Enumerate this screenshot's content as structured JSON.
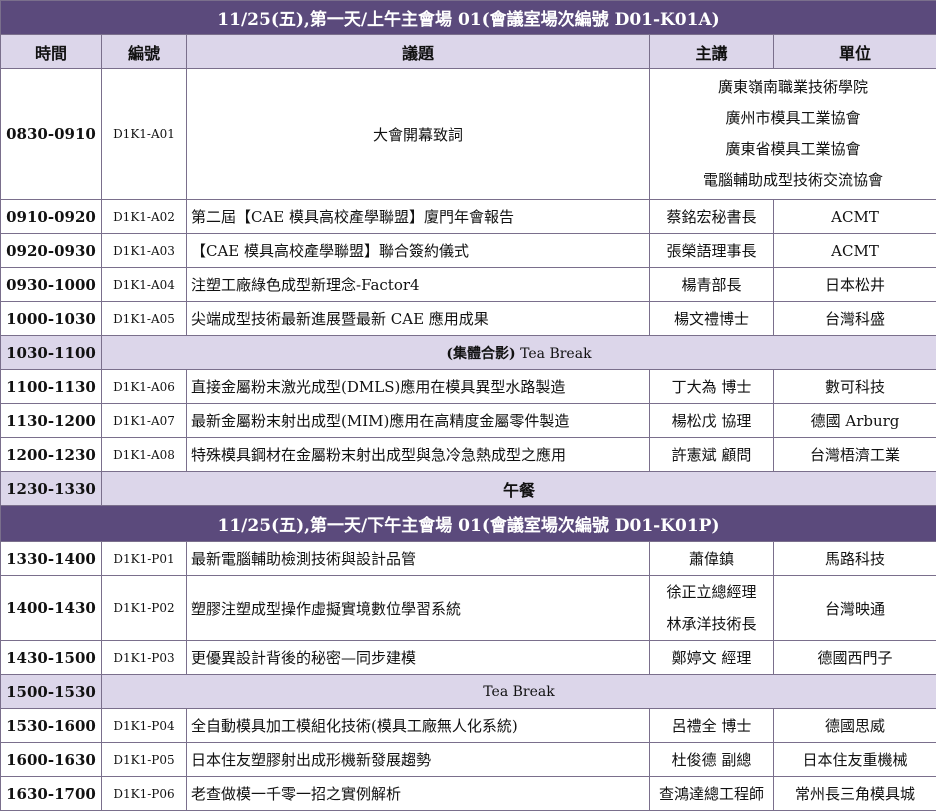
{
  "morning": {
    "banner": "11/25(五),第一天/上午主會場 01(會議室場次編號 D01-K01A)",
    "headers": {
      "time": "時間",
      "code": "編號",
      "topic": "議題",
      "speaker": "主講",
      "org": "單位"
    },
    "opening": {
      "time": "0830-0910",
      "code": "D1K1-A01",
      "topic": "大會開幕致詞",
      "orgs": [
        "廣東嶺南職業技術學院",
        "廣州市模具工業協會",
        "廣東省模具工業協會",
        "電腦輔助成型技術交流協會"
      ]
    },
    "rows": [
      {
        "time": "0910-0920",
        "code": "D1K1-A02",
        "topic": "第二屆【CAE 模具高校產學聯盟】廈門年會報告",
        "speaker": "蔡銘宏秘書長",
        "org": "ACMT"
      },
      {
        "time": "0920-0930",
        "code": "D1K1-A03",
        "topic": "【CAE 模具高校產學聯盟】聯合簽約儀式",
        "speaker": "張榮語理事長",
        "org": "ACMT"
      },
      {
        "time": "0930-1000",
        "code": "D1K1-A04",
        "topic": "注塑工廠綠色成型新理念-Factor4",
        "speaker": "楊青部長",
        "org": "日本松井"
      },
      {
        "time": "1000-1030",
        "code": "D1K1-A05",
        "topic": "尖端成型技術最新進展暨最新 CAE 應用成果",
        "speaker": "楊文禮博士",
        "org": "台灣科盛"
      }
    ],
    "break1": {
      "time": "1030-1100",
      "bold_part": "(集體合影)",
      "label": " Tea Break"
    },
    "rows2": [
      {
        "time": "1100-1130",
        "code": "D1K1-A06",
        "topic": "直接金屬粉末激光成型(DMLS)應用在模具異型水路製造",
        "speaker": "丁大為 博士",
        "org": "數可科技"
      },
      {
        "time": "1130-1200",
        "code": "D1K1-A07",
        "topic": "最新金屬粉末射出成型(MIM)應用在高精度金屬零件製造",
        "speaker": "楊松戊 協理",
        "org": "德國 Arburg"
      },
      {
        "time": "1200-1230",
        "code": "D1K1-A08",
        "topic": "特殊模具鋼材在金屬粉末射出成型與急冷急熱成型之應用",
        "speaker": "許憲斌 顧問",
        "org": "台灣梧濟工業"
      }
    ],
    "lunch": {
      "time": "1230-1330",
      "label": "午餐"
    }
  },
  "afternoon": {
    "banner": "11/25(五),第一天/下午主會場 01(會議室場次編號 D01-K01P)",
    "row1": {
      "time": "1330-1400",
      "code": "D1K1-P01",
      "topic": "最新電腦輔助檢測技術與設計品管",
      "speaker": "蕭偉鎮",
      "org": "馬路科技"
    },
    "row2": {
      "time": "1400-1430",
      "code": "D1K1-P02",
      "topic": "塑膠注塑成型操作虛擬實境數位學習系統",
      "speakers": [
        "徐正立總經理",
        "林承洋技術長"
      ],
      "org": "台灣映通"
    },
    "row3": {
      "time": "1430-1500",
      "code": "D1K1-P03",
      "topic": "更優異設計背後的秘密—同步建模",
      "speaker": "鄭婷文 經理",
      "org": "德國西門子"
    },
    "break": {
      "time": "1500-1530",
      "label": "Tea Break"
    },
    "rows": [
      {
        "time": "1530-1600",
        "code": "D1K1-P04",
        "topic": "全自動模具加工模組化技術(模具工廠無人化系統)",
        "speaker": "呂禮全 博士",
        "org": "德國思威"
      },
      {
        "time": "1600-1630",
        "code": "D1K1-P05",
        "topic": "日本住友塑膠射出成形機新發展趨勢",
        "speaker": "杜俊德 副總",
        "org": "日本住友重機械"
      },
      {
        "time": "1630-1700",
        "code": "D1K1-P06",
        "topic": "老查做模一千零一招之實例解析",
        "speaker": "查鴻達總工程師",
        "org": "常州長三角模具城"
      }
    ]
  }
}
